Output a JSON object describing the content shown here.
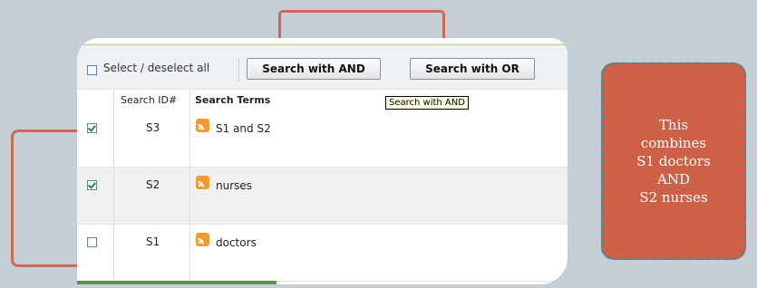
{
  "toolbar": {
    "select_all_label": "Select / deselect all",
    "search_and_label": "Search with AND",
    "search_or_label": "Search with OR"
  },
  "table": {
    "headers": [
      "",
      "Search ID#",
      "Search Terms"
    ],
    "rows": [
      {
        "checked": true,
        "id": "S3",
        "term": "S1 and S2"
      },
      {
        "checked": true,
        "id": "S2",
        "term": "nurses"
      },
      {
        "checked": false,
        "id": "S1",
        "term": "doctors"
      }
    ]
  },
  "tooltip": {
    "text": "Search with AND"
  },
  "callout": {
    "lines": [
      "This",
      "combines",
      "S1 doctors",
      "AND",
      "S2 nurses"
    ]
  },
  "colors": {
    "bracket": "#c96a52",
    "callout_fill": "#cc6148",
    "callout_border": "#3b8a9e",
    "background": "#c5ced4",
    "rss_icon": "#f29b33"
  }
}
